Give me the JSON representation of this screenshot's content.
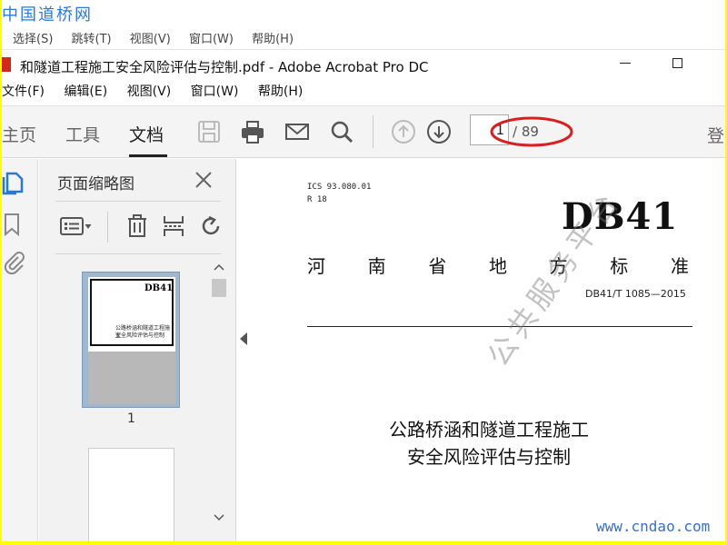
{
  "watermark_top": "中国道桥网",
  "watermark_bottom": "www.cndao.com",
  "background_menu": [
    "选择(S)",
    "跳转(T)",
    "视图(V)",
    "窗口(W)",
    "帮助(H)"
  ],
  "window": {
    "title": "和隧道工程施工安全风险评估与控制.pdf - Adobe Acrobat Pro DC"
  },
  "menubar": [
    "文件(F)",
    "编辑(E)",
    "视图(V)",
    "窗口(W)",
    "帮助(H)"
  ],
  "toolbar": {
    "tabs": [
      "主页",
      "工具",
      "文档"
    ],
    "icons": [
      "save-icon",
      "print-icon",
      "email-icon",
      "search-icon",
      "page-up-icon",
      "page-down-icon"
    ],
    "current_page": "1",
    "total_pages": "/ 89",
    "signin": "登"
  },
  "thumbnails": {
    "title": "页面缩略图",
    "page1_label": "1",
    "page1_db": "DB41",
    "page1_text1": "公路桥涵和隧道工程施工",
    "page1_text2": "安全风险评估与控制"
  },
  "document": {
    "ics": "ICS 93.080.01",
    "r18": "R 18",
    "db41": "DB41",
    "standard_chars": [
      "河",
      "南",
      "省",
      "地",
      "方",
      "标",
      "准"
    ],
    "number": "DB41/T 1085—2015",
    "title_line1": "公路桥涵和隧道工程施工",
    "title_line2": "安全风险评估与控制",
    "watermark": "公共服务平台"
  },
  "colors": {
    "frame": "#ffff00",
    "annotation_ellipse": "#d82020",
    "watermark_blue": "#2a7ad6"
  }
}
